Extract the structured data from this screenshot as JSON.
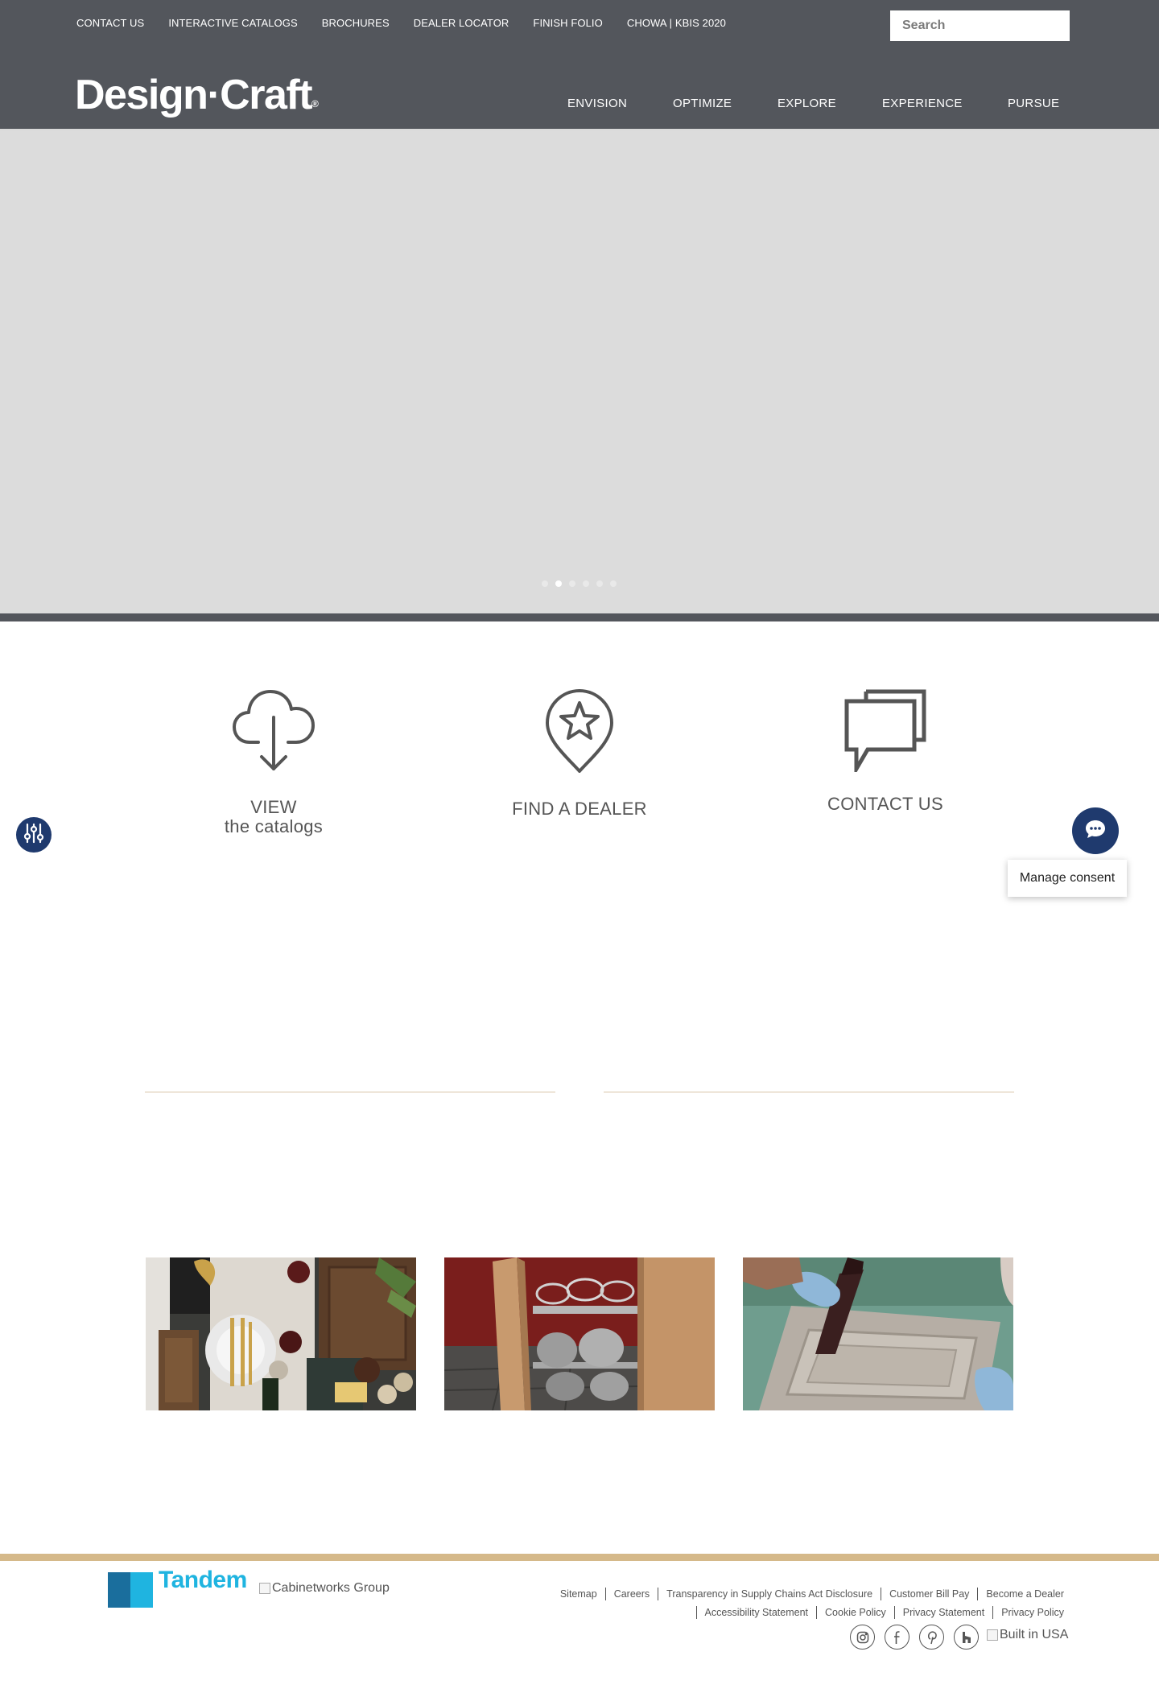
{
  "header": {
    "utility_links": [
      "CONTACT US",
      "INTERACTIVE CATALOGS",
      "BROCHURES",
      "DEALER LOCATOR",
      "FINISH FOLIO",
      "CHOWA | KBIS 2020"
    ],
    "search_placeholder": "Search",
    "logo_text": "Design·Craft",
    "logo_mark": "®",
    "main_nav": [
      "ENVISION",
      "OPTIMIZE",
      "EXPLORE",
      "EXPERIENCE",
      "PURSUE"
    ],
    "background_color": "#53565c"
  },
  "hero": {
    "slide_count": 6,
    "active_slide_index": 1,
    "background_color": "#dcdcdc"
  },
  "features": [
    {
      "icon": "cloud-download-icon",
      "line1": "VIEW",
      "line2": "the catalogs"
    },
    {
      "icon": "location-star-icon",
      "line1": "FIND A DEALER",
      "line2": ""
    },
    {
      "icon": "chat-bubbles-icon",
      "line1": "CONTACT US",
      "line2": ""
    }
  ],
  "consent": {
    "label": "Manage consent"
  },
  "tiles": [
    {
      "subject": "styled-table-setting"
    },
    {
      "subject": "pull-out-cookware-organizer"
    },
    {
      "subject": "hand-painting-cabinet-door"
    }
  ],
  "footer": {
    "brand": "Tandem",
    "partner_alt": "Cabinetworks Group",
    "links_row1": [
      "Sitemap",
      "Careers",
      "Transparency in Supply Chains Act Disclosure",
      "Customer Bill Pay",
      "Become a Dealer"
    ],
    "links_row2": [
      "Accessibility Statement",
      "Cookie Policy",
      "Privacy Statement",
      "Privacy Policy"
    ],
    "social": [
      "instagram-icon",
      "facebook-icon",
      "pinterest-icon",
      "houzz-icon"
    ],
    "built_alt": "Built in USA",
    "accent_color": "#d5b98a"
  },
  "colors": {
    "accent_blue": "#1f3a6e",
    "tandem_blue": "#1fb4e0"
  }
}
